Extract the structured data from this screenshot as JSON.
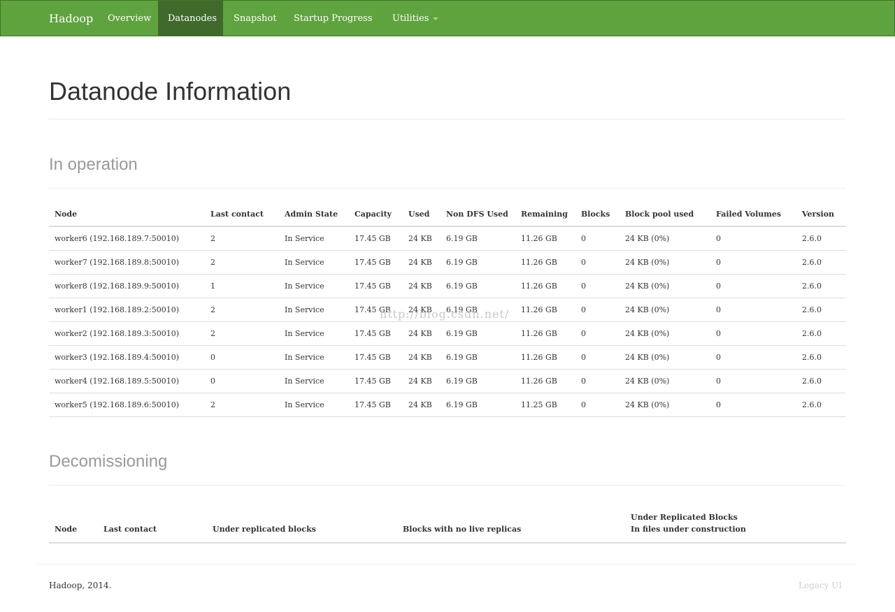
{
  "navbar": {
    "brand": "Hadoop",
    "items": [
      {
        "label": "Overview"
      },
      {
        "label": "Datanodes"
      },
      {
        "label": "Snapshot"
      },
      {
        "label": "Startup Progress"
      },
      {
        "label": "Utilities"
      }
    ],
    "active": "Datanodes",
    "color": "#5fa33e"
  },
  "page": {
    "title": "Datanode Information"
  },
  "in_operation": {
    "title": "In operation",
    "columns": [
      "Node",
      "Last contact",
      "Admin State",
      "Capacity",
      "Used",
      "Non DFS Used",
      "Remaining",
      "Blocks",
      "Block pool used",
      "Failed Volumes",
      "Version"
    ],
    "rows": [
      [
        "worker6 (192.168.189.7:50010)",
        "2",
        "In Service",
        "17.45 GB",
        "24 KB",
        "6.19 GB",
        "11.26 GB",
        "0",
        "24 KB (0%)",
        "0",
        "2.6.0"
      ],
      [
        "worker7 (192.168.189.8:50010)",
        "2",
        "In Service",
        "17.45 GB",
        "24 KB",
        "6.19 GB",
        "11.26 GB",
        "0",
        "24 KB (0%)",
        "0",
        "2.6.0"
      ],
      [
        "worker8 (192.168.189.9:50010)",
        "1",
        "In Service",
        "17.45 GB",
        "24 KB",
        "6.19 GB",
        "11.26 GB",
        "0",
        "24 KB (0%)",
        "0",
        "2.6.0"
      ],
      [
        "worker1 (192.168.189.2:50010)",
        "2",
        "In Service",
        "17.45 GB",
        "24 KB",
        "6.19 GB",
        "11.26 GB",
        "0",
        "24 KB (0%)",
        "0",
        "2.6.0"
      ],
      [
        "worker2 (192.168.189.3:50010)",
        "2",
        "In Service",
        "17.45 GB",
        "24 KB",
        "6.19 GB",
        "11.26 GB",
        "0",
        "24 KB (0%)",
        "0",
        "2.6.0"
      ],
      [
        "worker3 (192.168.189.4:50010)",
        "0",
        "In Service",
        "17.45 GB",
        "24 KB",
        "6.19 GB",
        "11.26 GB",
        "0",
        "24 KB (0%)",
        "0",
        "2.6.0"
      ],
      [
        "worker4 (192.168.189.5:50010)",
        "0",
        "In Service",
        "17.45 GB",
        "24 KB",
        "6.19 GB",
        "11.26 GB",
        "0",
        "24 KB (0%)",
        "0",
        "2.6.0"
      ],
      [
        "worker5 (192.168.189.6:50010)",
        "2",
        "In Service",
        "17.45 GB",
        "24 KB",
        "6.19 GB",
        "11.25 GB",
        "0",
        "24 KB (0%)",
        "0",
        "2.6.0"
      ]
    ]
  },
  "decommissioning": {
    "title": "Decomissioning",
    "columns": [
      "Node",
      "Last contact",
      "Under replicated blocks",
      "Blocks with no live replicas",
      "Under Replicated Blocks",
      "In files under construction"
    ]
  },
  "footer": {
    "left": "Hadoop, 2014.",
    "right": "Legacy UI"
  },
  "watermark": "http://blog.csdn.net/"
}
